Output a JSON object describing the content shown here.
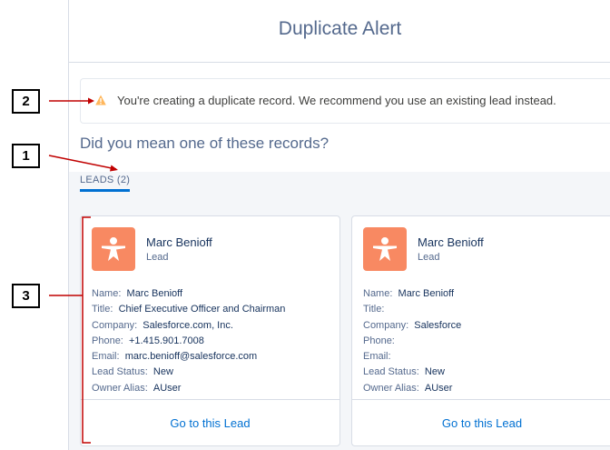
{
  "modal": {
    "title": "Duplicate Alert",
    "alert_text": "You're creating a duplicate record. We recommend you use an existing lead instead.",
    "question": "Did you mean one of these records?",
    "tab_label": "LEADS (2)"
  },
  "callouts": [
    "2",
    "1",
    "3"
  ],
  "labels": {
    "name": "Name:",
    "title": "Title:",
    "company": "Company:",
    "phone": "Phone:",
    "email": "Email:",
    "lead_status": "Lead Status:",
    "owner_alias": "Owner Alias:"
  },
  "cards": [
    {
      "name": "Marc Benioff",
      "type": "Lead",
      "fields": {
        "name": "Marc Benioff",
        "title": "Chief Executive Officer and Chairman",
        "company": "Salesforce.com, Inc.",
        "phone": "+1.415.901.7008",
        "email": "marc.benioff@salesforce.com",
        "lead_status": "New",
        "owner_alias": "AUser"
      },
      "link": "Go to this Lead"
    },
    {
      "name": "Marc Benioff",
      "type": "Lead",
      "fields": {
        "name": "Marc Benioff",
        "title": "",
        "company": "Salesforce",
        "phone": "",
        "email": "",
        "lead_status": "New",
        "owner_alias": "AUser"
      },
      "link": "Go to this Lead"
    }
  ],
  "colors": {
    "accent": "#0070d2",
    "lead_icon_bg": "#f88962",
    "warning": "#ffb75d"
  },
  "icons": [
    "warning-icon",
    "lead-icon"
  ]
}
